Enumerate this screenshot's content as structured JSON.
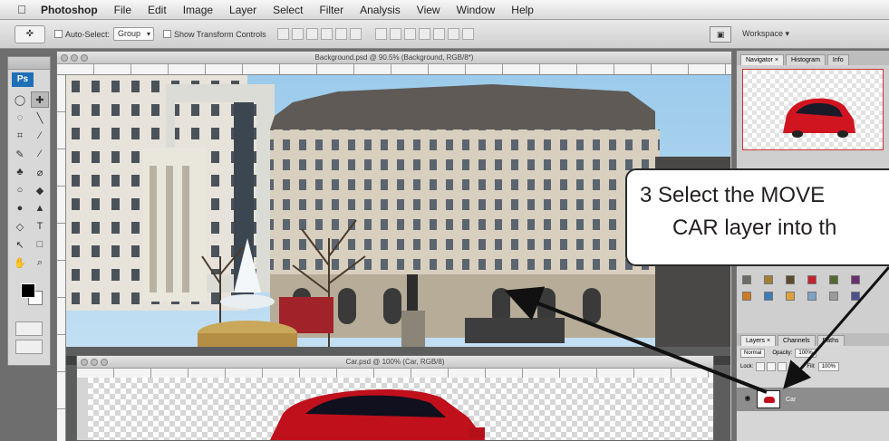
{
  "menubar": {
    "apple": "",
    "items": [
      "Photoshop",
      "File",
      "Edit",
      "Image",
      "Layer",
      "Select",
      "Filter",
      "Analysis",
      "View",
      "Window",
      "Help"
    ]
  },
  "options": {
    "auto_select": "Auto-Select:",
    "auto_select_value": "Group",
    "transform_controls": "Show Transform Controls",
    "workspace": "Workspace ▾"
  },
  "tools": {
    "logo": "Ps",
    "glyphs": [
      "◯",
      "✚",
      "◌",
      "╲",
      "⌗",
      "∕",
      "✎",
      "⁄",
      "♣",
      "⌀",
      "○",
      "◆",
      "●",
      "▲",
      "◇",
      "T",
      "↖",
      "□",
      "✋",
      "⌕"
    ]
  },
  "background_doc": {
    "title": "Background.psd @ 90.5% (Background, RGB/8*)"
  },
  "car_doc": {
    "title": "Car.psd @ 100% (Car, RGB/8)"
  },
  "panels": {
    "nav_tabs": [
      "Navigator ×",
      "Histogram",
      "Info"
    ],
    "layer_tabs": [
      "Layers ×",
      "Channels",
      "Paths"
    ],
    "blend_mode": "Normal",
    "opacity_label": "Opacity:",
    "opacity_value": "100%",
    "lock_label": "Lock:",
    "fill_label": "Fill:",
    "fill_value": "100%",
    "layer_name": "Car"
  },
  "callout": {
    "line1": "3  Select the MOVE",
    "line2": "CAR layer into th"
  },
  "colors": {
    "car_red": "#c0101c",
    "callout_border": "#2a2a2a"
  }
}
